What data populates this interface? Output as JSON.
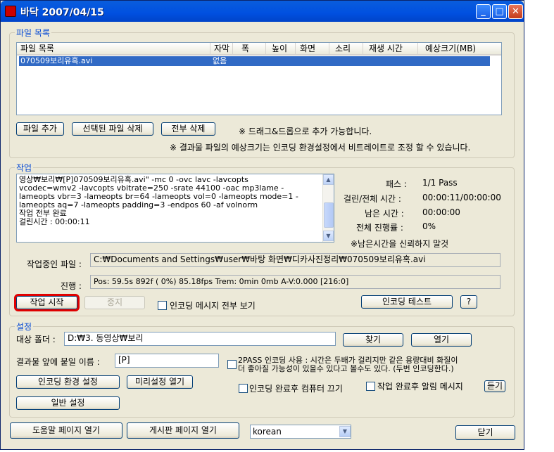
{
  "window": {
    "title": "바닥 2007/04/15"
  },
  "file_list": {
    "group_title": "파일 목록",
    "columns": [
      "파일 목록",
      "자막",
      "폭",
      "높이",
      "화면",
      "소리",
      "재생 시간",
      "예상크기(MB)"
    ],
    "rows": [
      {
        "name": "070509보리유혹.avi",
        "subtitle": "없음"
      }
    ],
    "buttons": {
      "add": "파일 추가",
      "remove_selected": "선택된 파일 삭제",
      "remove_all": "전부 삭제"
    },
    "note_drag": "※ 드래그&드롭으로 추가 가능합니다.",
    "note_size": "※ 결과물 파일의 예상크기는 인코딩 환경설정에서 비트레이트로 조정 할 수 있습니다."
  },
  "job": {
    "group_title": "작업",
    "log_lines": [
      "영상₩보리₩[P]070509보리유혹.avi\" -mc 0 -ovc lavc -lavcopts",
      "vcodec=wmv2    -lavcopts vbitrate=250 -srate 44100 -oac mp3lame -",
      "lameopts vbr=3   -lameopts br=64 -lameopts vol=0 -lameopts mode=1 -",
      "lameopts aq=7 -lameopts padding=3 -endpos 60 -af volnorm",
      "작업 전부 완료",
      "걸린시간 : 00:00:11"
    ],
    "stats": {
      "pass_label": "패스 :",
      "pass_value": "1/1 Pass",
      "elapsed_label": "걸린/전체 시간 :",
      "elapsed_value": "00:00:11/00:00:00",
      "remaining_label": "남은 시간 :",
      "remaining_value": "00:00:00",
      "progress_label": "전체 진행률 :",
      "progress_value": "0%"
    },
    "note_remaining": "※남은시간을 신뢰하지 말것",
    "current_file_label": "작업중인 파일 :",
    "current_file_value": "C:₩Documents and Settings₩user₩바탕 화면₩디카사진정리₩070509보리유혹.avi",
    "progress_label": "진행 :",
    "progress_text": "Pos:  59.5s    892f ( 0%) 85.18fps Trem:    0min    0mb  A-V:0.000 [216:0]",
    "buttons": {
      "start": "작업 시작",
      "stop": "중지",
      "encode_test": "인코딩 테스트",
      "help": "?"
    },
    "show_all_messages_label": "인코딩 메시지 전부 보기"
  },
  "settings": {
    "group_title": "설정",
    "target_folder_label": "대상 폴더 :",
    "target_folder_value": "D:₩3. 동영상₩보리",
    "browse_button": "찾기",
    "open_button": "열기",
    "prefix_label": "결과물 앞에 붙일 이름 :",
    "prefix_value": "[P]",
    "twopass_line1": "2PASS 인코딩 사용 : 시간은 두배가 걸리지만 같은 용량대비 화질이",
    "twopass_line2": "더 좋아질 가능성이 있을수 있다고 볼수도 있다. (두번 인코딩한다.)",
    "encoding_settings_button": "인코딩 환경 설정",
    "preset_open_button": "미리설정 열기",
    "shutdown_label": "인코딩 완료후 컴퓨터 끄기",
    "notify_label": "작업 완료후 알림 메시지",
    "listen_button": "듣기",
    "general_settings_button": "일반 설정"
  },
  "bottom": {
    "help_button": "도움말 페이지 열기",
    "board_button": "게시판 페이지 열기",
    "language_value": "korean",
    "close_button": "닫기"
  }
}
